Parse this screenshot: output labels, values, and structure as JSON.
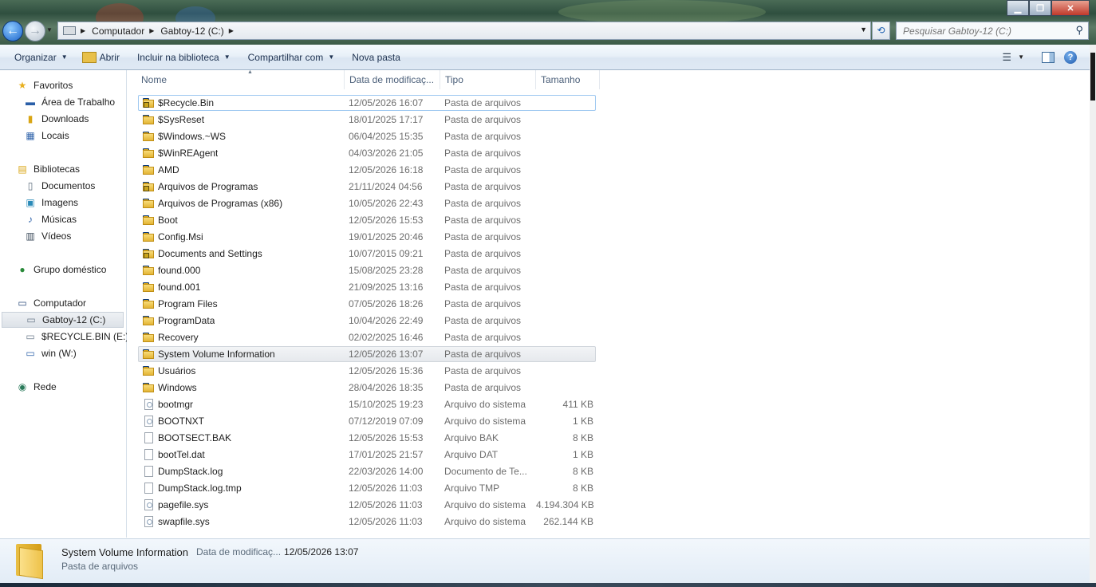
{
  "address": {
    "crumbs": [
      "Computador",
      "Gabtoy-12 (C:)"
    ]
  },
  "search": {
    "placeholder": "Pesquisar Gabtoy-12 (C:)"
  },
  "toolbar": {
    "organize": "Organizar",
    "open": "Abrir",
    "include": "Incluir na biblioteca",
    "share": "Compartilhar com",
    "new_folder": "Nova pasta"
  },
  "nav": {
    "favorites": "Favoritos",
    "desktop": "Área de Trabalho",
    "downloads": "Downloads",
    "locais": "Locais",
    "libraries": "Bibliotecas",
    "documents": "Documentos",
    "images": "Imagens",
    "music": "Músicas",
    "videos": "Vídeos",
    "homegroup": "Grupo doméstico",
    "computer": "Computador",
    "drive_c": "Gabtoy-12 (C:)",
    "drive_e": "$RECYCLE.BIN (E:)",
    "drive_w": "win (W:)",
    "network": "Rede"
  },
  "columns": {
    "name": "Nome",
    "date": "Data de modificaç...",
    "type": "Tipo",
    "size": "Tamanho"
  },
  "files": [
    {
      "name": "$Recycle.Bin",
      "date": "12/05/2026 16:07",
      "type": "Pasta de arquivos",
      "size": "",
      "icon": "locked-folder-icon"
    },
    {
      "name": "$SysReset",
      "date": "18/01/2025 17:17",
      "type": "Pasta de arquivos",
      "size": "",
      "icon": "folder-icon"
    },
    {
      "name": "$Windows.~WS",
      "date": "06/04/2025 15:35",
      "type": "Pasta de arquivos",
      "size": "",
      "icon": "folder-icon"
    },
    {
      "name": "$WinREAgent",
      "date": "04/03/2026 21:05",
      "type": "Pasta de arquivos",
      "size": "",
      "icon": "folder-icon"
    },
    {
      "name": "AMD",
      "date": "12/05/2026 16:18",
      "type": "Pasta de arquivos",
      "size": "",
      "icon": "folder-icon"
    },
    {
      "name": "Arquivos de Programas",
      "date": "21/11/2024 04:56",
      "type": "Pasta de arquivos",
      "size": "",
      "icon": "locked-folder-icon"
    },
    {
      "name": "Arquivos de Programas (x86)",
      "date": "10/05/2026 22:43",
      "type": "Pasta de arquivos",
      "size": "",
      "icon": "folder-icon"
    },
    {
      "name": "Boot",
      "date": "12/05/2026 15:53",
      "type": "Pasta de arquivos",
      "size": "",
      "icon": "folder-icon"
    },
    {
      "name": "Config.Msi",
      "date": "19/01/2025 20:46",
      "type": "Pasta de arquivos",
      "size": "",
      "icon": "folder-icon"
    },
    {
      "name": "Documents and Settings",
      "date": "10/07/2015 09:21",
      "type": "Pasta de arquivos",
      "size": "",
      "icon": "locked-folder-icon"
    },
    {
      "name": "found.000",
      "date": "15/08/2025 23:28",
      "type": "Pasta de arquivos",
      "size": "",
      "icon": "folder-icon"
    },
    {
      "name": "found.001",
      "date": "21/09/2025 13:16",
      "type": "Pasta de arquivos",
      "size": "",
      "icon": "folder-icon"
    },
    {
      "name": "Program Files",
      "date": "07/05/2026 18:26",
      "type": "Pasta de arquivos",
      "size": "",
      "icon": "folder-icon"
    },
    {
      "name": "ProgramData",
      "date": "10/04/2026 22:49",
      "type": "Pasta de arquivos",
      "size": "",
      "icon": "folder-icon"
    },
    {
      "name": "Recovery",
      "date": "02/02/2025 16:46",
      "type": "Pasta de arquivos",
      "size": "",
      "icon": "folder-icon"
    },
    {
      "name": "System Volume Information",
      "date": "12/05/2026 13:07",
      "type": "Pasta de arquivos",
      "size": "",
      "icon": "folder-icon"
    },
    {
      "name": "Usuários",
      "date": "12/05/2026 15:36",
      "type": "Pasta de arquivos",
      "size": "",
      "icon": "folder-icon"
    },
    {
      "name": "Windows",
      "date": "28/04/2026 18:35",
      "type": "Pasta de arquivos",
      "size": "",
      "icon": "folder-icon"
    },
    {
      "name": "bootmgr",
      "date": "15/10/2025 19:23",
      "type": "Arquivo do sistema",
      "size": "411 KB",
      "icon": "system-file-icon"
    },
    {
      "name": "BOOTNXT",
      "date": "07/12/2019 07:09",
      "type": "Arquivo do sistema",
      "size": "1 KB",
      "icon": "system-file-icon"
    },
    {
      "name": "BOOTSECT.BAK",
      "date": "12/05/2026 15:53",
      "type": "Arquivo BAK",
      "size": "8 KB",
      "icon": "file-icon"
    },
    {
      "name": "bootTel.dat",
      "date": "17/01/2025 21:57",
      "type": "Arquivo DAT",
      "size": "1 KB",
      "icon": "file-icon"
    },
    {
      "name": "DumpStack.log",
      "date": "22/03/2026 14:00",
      "type": "Documento de Te...",
      "size": "8 KB",
      "icon": "file-icon"
    },
    {
      "name": "DumpStack.log.tmp",
      "date": "12/05/2026 11:03",
      "type": "Arquivo TMP",
      "size": "8 KB",
      "icon": "file-icon"
    },
    {
      "name": "pagefile.sys",
      "date": "12/05/2026 11:03",
      "type": "Arquivo do sistema",
      "size": "4.194.304 KB",
      "icon": "system-file-icon"
    },
    {
      "name": "swapfile.sys",
      "date": "12/05/2026 11:03",
      "type": "Arquivo do sistema",
      "size": "262.144 KB",
      "icon": "system-file-icon"
    }
  ],
  "details": {
    "name": "System Volume Information",
    "modified_label": "Data de modificaç...",
    "modified_value": "12/05/2026 13:07",
    "type": "Pasta de arquivos"
  }
}
